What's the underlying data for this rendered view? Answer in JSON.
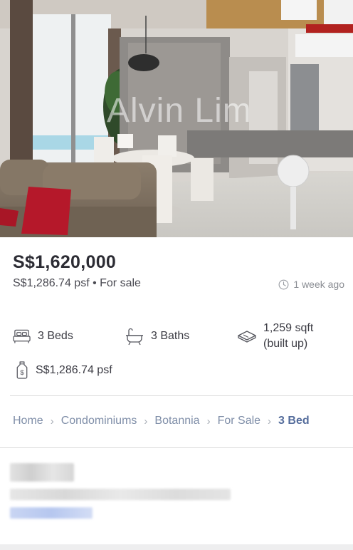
{
  "photo": {
    "watermark": "Alvin Lim",
    "alt": "Condo living room with sofa, dining table and kitchen"
  },
  "listing": {
    "price": "S$1,620,000",
    "psf_line": "S$1,286.74 psf • For sale",
    "posted": "1 week ago"
  },
  "features": {
    "beds": "3 Beds",
    "baths": "3 Baths",
    "size_line1": "1,259 sqft",
    "size_line2": "(built up)",
    "psf": "S$1,286.74 psf"
  },
  "breadcrumb": {
    "items": [
      "Home",
      "Condominiums",
      "Botannia",
      "For Sale"
    ],
    "current": "3 Bed"
  },
  "icons": {
    "posted": "clock-icon",
    "beds": "bed-icon",
    "baths": "bathtub-icon",
    "size": "floor-area-icon",
    "psf": "price-tag-icon",
    "separator": "chevron-right-icon"
  },
  "colors": {
    "price": "#2c2c34",
    "muted": "#8a8d93",
    "breadcrumb": "#7f8ea8",
    "breadcrumb_current": "#556d9c"
  }
}
